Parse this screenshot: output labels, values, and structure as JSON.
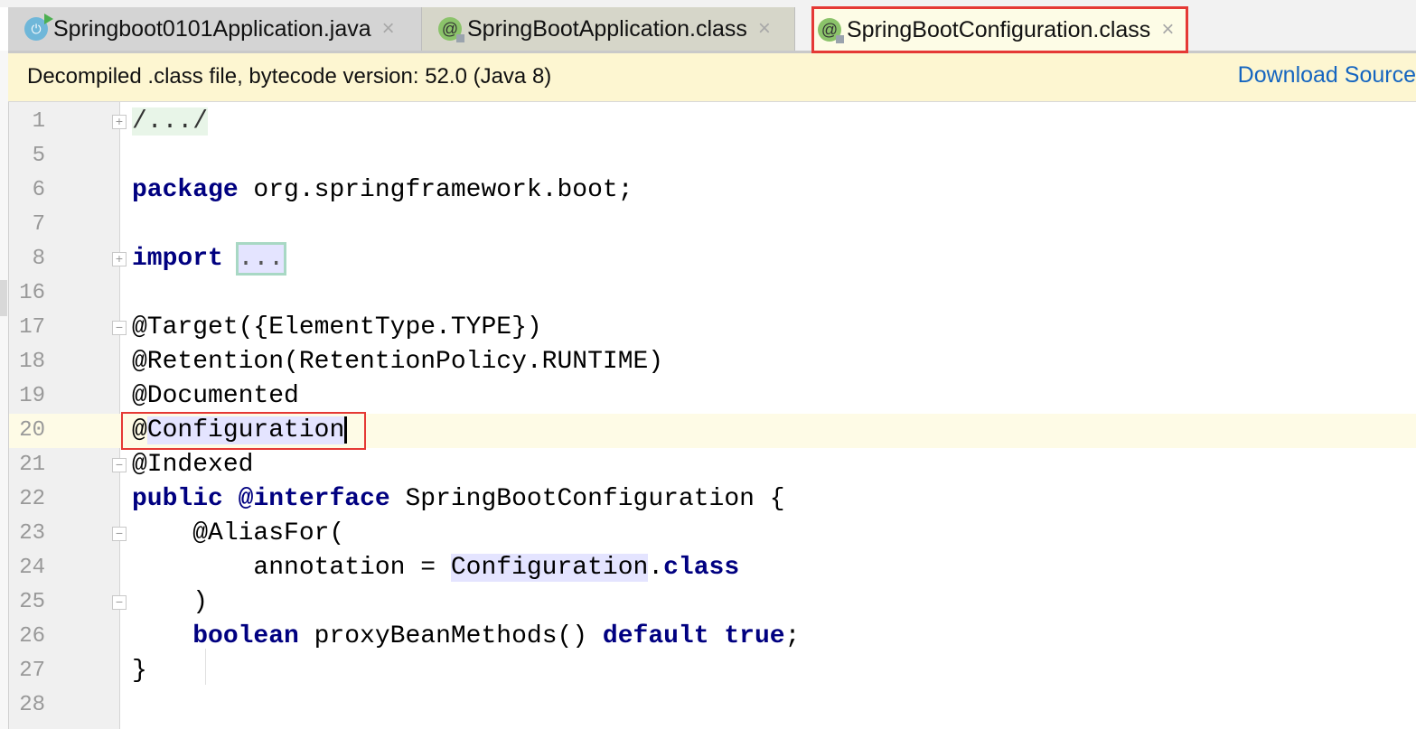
{
  "tabs": [
    {
      "label": "Springboot0101Application.java",
      "icon": "spring-boot-run-class-icon",
      "active": false
    },
    {
      "label": "SpringBootApplication.class",
      "icon": "annotation-locked-icon",
      "active": false
    },
    {
      "label": "SpringBootConfiguration.class",
      "icon": "annotation-locked-icon",
      "active": true
    }
  ],
  "close_glyph": "×",
  "notice": {
    "message": "Decompiled .class file, bytecode version: 52.0 (Java 8)",
    "download_link": "Download Source"
  },
  "colors": {
    "keyword": "#000080",
    "highlight_box": "#e53935",
    "link": "#1565c0",
    "notice_bg": "#fdf6d1"
  },
  "editor": {
    "current_line": "20",
    "lines": [
      {
        "n": "1",
        "fold": "plus",
        "tokens": [
          {
            "t": "/.../",
            "c": "fold"
          }
        ]
      },
      {
        "n": "5",
        "tokens": []
      },
      {
        "n": "6",
        "tokens": [
          {
            "t": "package",
            "c": "kw"
          },
          {
            "t": " org.springframework.boot;"
          }
        ]
      },
      {
        "n": "7",
        "tokens": []
      },
      {
        "n": "8",
        "fold": "plus",
        "tokens": [
          {
            "t": "import",
            "c": "kw"
          },
          {
            "t": " "
          },
          {
            "t": "...",
            "c": "foldbox"
          }
        ]
      },
      {
        "n": "16",
        "tokens": []
      },
      {
        "n": "17",
        "fold": "minus",
        "tokens": [
          {
            "t": "@Target({ElementType.TYPE})"
          }
        ]
      },
      {
        "n": "18",
        "tokens": [
          {
            "t": "@Retention(RetentionPolicy.RUNTIME)"
          }
        ]
      },
      {
        "n": "19",
        "tokens": [
          {
            "t": "@Documented"
          }
        ]
      },
      {
        "n": "20",
        "tokens": [
          {
            "t": "@"
          },
          {
            "t": "Configuration",
            "c": "hl"
          },
          {
            "t": "",
            "c": "caret"
          }
        ]
      },
      {
        "n": "21",
        "fold": "minus",
        "tokens": [
          {
            "t": "@Indexed"
          }
        ]
      },
      {
        "n": "22",
        "tokens": [
          {
            "t": "public",
            "c": "kw"
          },
          {
            "t": " "
          },
          {
            "t": "@interface",
            "c": "kw"
          },
          {
            "t": " SpringBootConfiguration {"
          }
        ]
      },
      {
        "n": "23",
        "fold": "minus",
        "tokens": [
          {
            "t": "    @AliasFor("
          }
        ]
      },
      {
        "n": "24",
        "tokens": [
          {
            "t": "        annotation = "
          },
          {
            "t": "Configuration",
            "c": "hl"
          },
          {
            "t": "."
          },
          {
            "t": "class",
            "c": "kw"
          }
        ]
      },
      {
        "n": "25",
        "fold": "minus",
        "tokens": [
          {
            "t": "    )"
          }
        ]
      },
      {
        "n": "26",
        "tokens": [
          {
            "t": "    "
          },
          {
            "t": "boolean",
            "c": "kw"
          },
          {
            "t": " proxyBeanMethods() "
          },
          {
            "t": "default",
            "c": "kw"
          },
          {
            "t": " "
          },
          {
            "t": "true",
            "c": "kw"
          },
          {
            "t": ";"
          }
        ]
      },
      {
        "n": "27",
        "tokens": [
          {
            "t": "}"
          }
        ]
      },
      {
        "n": "28",
        "tokens": []
      }
    ]
  }
}
